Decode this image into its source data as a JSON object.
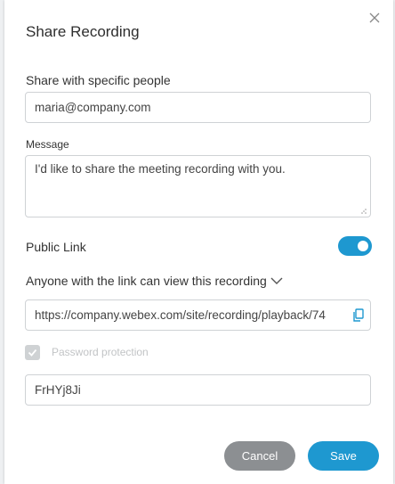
{
  "dialog": {
    "title": "Share Recording",
    "close_icon": "close-icon"
  },
  "share_people": {
    "label": "Share with specific people",
    "value": "maria@company.com"
  },
  "message": {
    "label": "Message",
    "value": "I'd like to share the meeting recording with you."
  },
  "public_link": {
    "label": "Public Link",
    "enabled": true,
    "access_text": "Anyone with the link can view this recording",
    "url": "https://company.webex.com/site/recording/playback/74",
    "copy_icon": "copy-icon"
  },
  "password": {
    "checkbox_label": "Password protection",
    "checked": true,
    "disabled": true,
    "value": "FrHYj8Ji"
  },
  "actions": {
    "cancel_label": "Cancel",
    "save_label": "Save"
  },
  "colors": {
    "accent": "#1e98d0",
    "cancel_button": "#8c8f92",
    "disabled_checkbox": "#cfd2d4"
  }
}
